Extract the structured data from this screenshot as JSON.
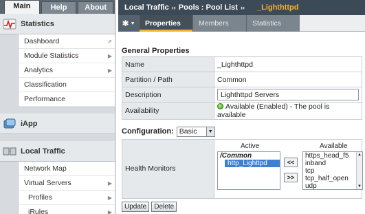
{
  "sidebar": {
    "tabs": [
      {
        "label": "Main",
        "active": true
      },
      {
        "label": "Help",
        "active": false
      },
      {
        "label": "About",
        "active": false
      }
    ],
    "statistics": {
      "title": "Statistics",
      "items": [
        "Dashboard",
        "Module Statistics",
        "Analytics",
        "Classification",
        "Performance"
      ]
    },
    "iapp": {
      "title": "iApp"
    },
    "local_traffic": {
      "title": "Local Traffic",
      "items": [
        "Network Map",
        "Virtual Servers"
      ],
      "sub_items": [
        "Profiles",
        "iRules"
      ]
    }
  },
  "breadcrumb": {
    "part1": "Local Traffic",
    "sep": "››",
    "part2": "Pools : Pool List",
    "pool": "_Lighthttpd"
  },
  "tabs": [
    {
      "label": "Properties",
      "active": true
    },
    {
      "label": "Members",
      "active": false
    },
    {
      "label": "Statistics",
      "active": false
    }
  ],
  "general": {
    "title": "General Properties",
    "name_label": "Name",
    "name_value": "_Lighthttpd",
    "partition_label": "Partition / Path",
    "partition_value": "Common",
    "description_label": "Description",
    "description_value": "Lighthttpd Servers",
    "availability_label": "Availability",
    "availability_value": "Available (Enabled) - The pool is available",
    "availability_color": "#3f9f18"
  },
  "configuration": {
    "label": "Configuration:",
    "selected": "Basic"
  },
  "health_monitors": {
    "label": "Health Monitors",
    "active_header": "Active",
    "available_header": "Available",
    "active_group": "/Common",
    "active_items": [
      "http_Lighttpd"
    ],
    "available_items": [
      "https_head_f5",
      "inband",
      "tcp",
      "tcp_half_open",
      "udp"
    ],
    "move_left": "<<",
    "move_right": ">>"
  },
  "buttons": {
    "update": "Update",
    "delete": "Delete"
  }
}
